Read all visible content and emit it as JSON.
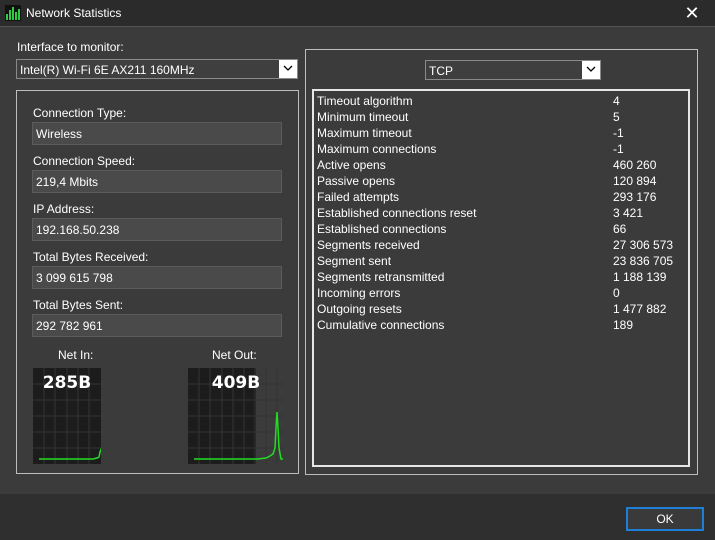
{
  "window": {
    "title": "Network Statistics",
    "close_glyph": "✕"
  },
  "interface": {
    "label": "Interface to monitor:",
    "selected": "Intel(R) Wi-Fi 6E AX211 160MHz"
  },
  "info": {
    "fields": [
      {
        "label": "Connection Type:",
        "value": "Wireless"
      },
      {
        "label": "Connection Speed:",
        "value": "219,4 Mbits"
      },
      {
        "label": "IP Address:",
        "value": "192.168.50.238"
      },
      {
        "label": "Total Bytes Received:",
        "value": "3 099 615 798"
      },
      {
        "label": "Total Bytes Sent:",
        "value": "292 782 961"
      }
    ]
  },
  "meters": {
    "net_in": {
      "label": "Net In:",
      "value": "285B"
    },
    "net_out": {
      "label": "Net Out:",
      "value": "409B"
    },
    "line_color": "#22dd22"
  },
  "protocol": {
    "selected": "TCP"
  },
  "stats": [
    {
      "name": "Timeout algorithm",
      "value": "4"
    },
    {
      "name": "Minimum timeout",
      "value": "5"
    },
    {
      "name": "Maximum timeout",
      "value": "-1"
    },
    {
      "name": "Maximum connections",
      "value": "-1"
    },
    {
      "name": "Active opens",
      "value": "460 260"
    },
    {
      "name": "Passive opens",
      "value": "120 894"
    },
    {
      "name": "Failed attempts",
      "value": "293 176"
    },
    {
      "name": "Established connections reset",
      "value": "3 421"
    },
    {
      "name": "Established connections",
      "value": "66"
    },
    {
      "name": "Segments received",
      "value": "27 306 573"
    },
    {
      "name": "Segment sent",
      "value": "23 836 705"
    },
    {
      "name": "Segments retransmitted",
      "value": "1 188 139"
    },
    {
      "name": "Incoming errors",
      "value": "0"
    },
    {
      "name": "Outgoing resets",
      "value": "1 477 882"
    },
    {
      "name": "Cumulative connections",
      "value": "189"
    }
  ],
  "footer": {
    "ok_label": "OK"
  }
}
